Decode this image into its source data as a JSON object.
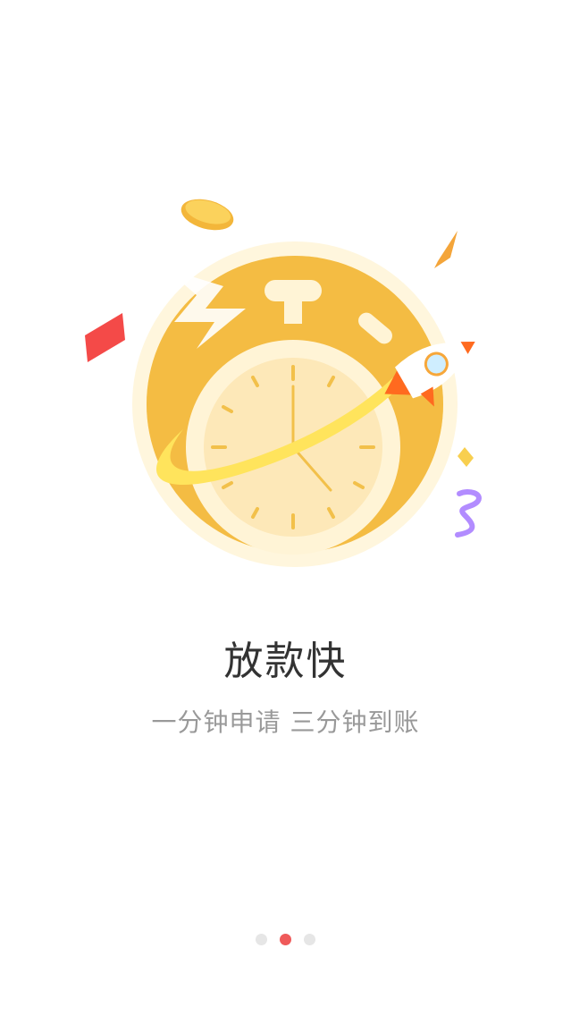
{
  "onboarding": {
    "title": "放款快",
    "subtitle": "一分钟申请 三分钟到账",
    "illustration_icon": "stopwatch-rocket-illustration",
    "pager": {
      "total": 3,
      "active_index": 1
    }
  },
  "colors": {
    "dot_inactive": "#e6e6e6",
    "dot_active": "#ef5a5a",
    "title": "#333333",
    "subtitle": "#999999",
    "coin_gold": "#f3b63a"
  }
}
